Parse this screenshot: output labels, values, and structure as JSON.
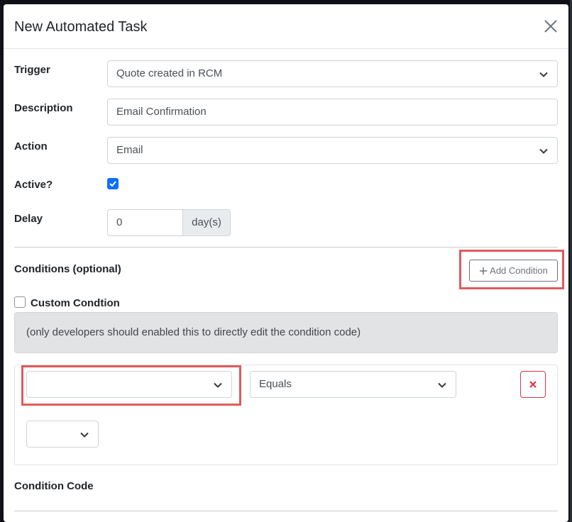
{
  "modal": {
    "title": "New Automated Task"
  },
  "form": {
    "trigger": {
      "label": "Trigger",
      "value": "Quote created in RCM"
    },
    "description": {
      "label": "Description",
      "value": "Email Confirmation"
    },
    "action": {
      "label": "Action",
      "value": "Email"
    },
    "active": {
      "label": "Active?",
      "checked": true
    },
    "delay": {
      "label": "Delay",
      "value": "0",
      "unit": "day(s)"
    }
  },
  "conditions": {
    "heading": "Conditions (optional)",
    "add_button_label": "Add Condition",
    "custom_label": "Custom Condtion",
    "custom_checked": false,
    "hint": "(only developers should enabled this to directly edit the condition code)",
    "row": {
      "field_value": "",
      "operator_value": "Equals",
      "value_value": ""
    },
    "code_heading": "Condition Code"
  },
  "colors": {
    "accent": "#0d6efd",
    "highlight": "#e05a5a",
    "danger": "#dc3545"
  },
  "icons": [
    "close-icon",
    "chevron-down-icon",
    "check-icon",
    "plus-icon",
    "x-icon"
  ]
}
